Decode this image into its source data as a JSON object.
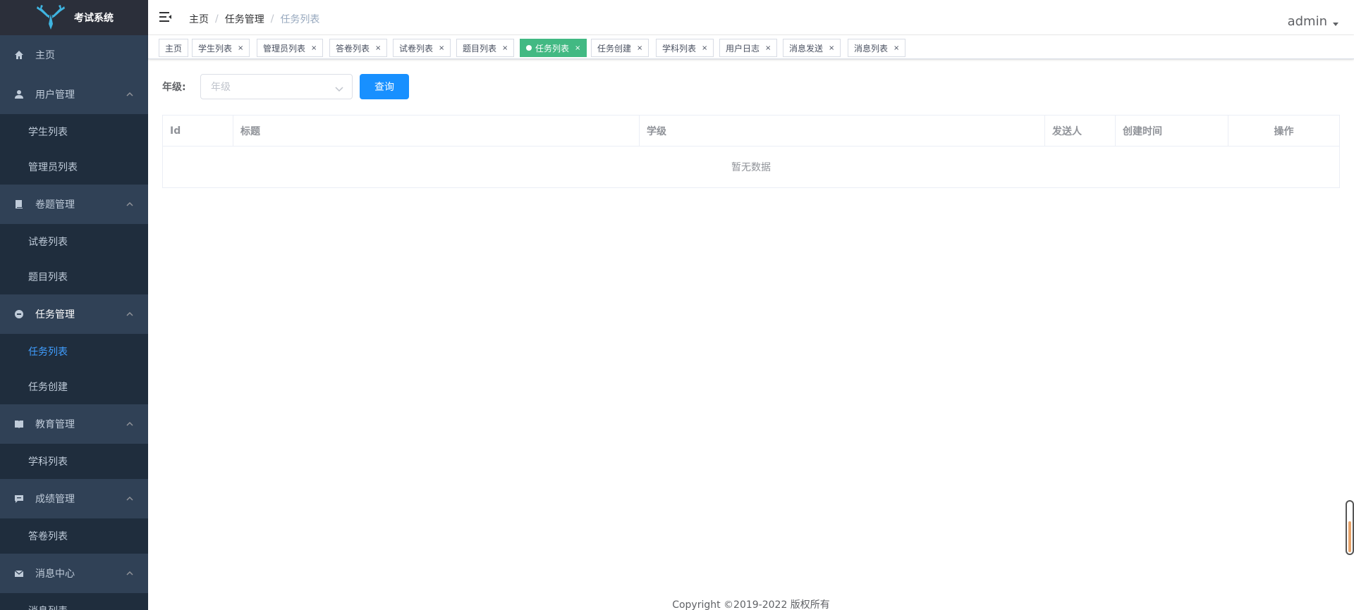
{
  "app": {
    "logo_text": "考试系统"
  },
  "sidebar": {
    "home": {
      "label": "主页",
      "icon": "home-icon"
    },
    "groups": [
      {
        "label": "用户管理",
        "icon": "user-icon",
        "items": [
          "学生列表",
          "管理员列表"
        ]
      },
      {
        "label": "卷题管理",
        "icon": "book-icon",
        "items": [
          "试卷列表",
          "题目列表"
        ]
      },
      {
        "label": "任务管理",
        "icon": "task-icon",
        "items": [
          "任务列表",
          "任务创建"
        ],
        "active_item": "任务列表"
      },
      {
        "label": "教育管理",
        "icon": "education-icon",
        "items": [
          "学科列表"
        ]
      },
      {
        "label": "成绩管理",
        "icon": "score-icon",
        "items": [
          "答卷列表"
        ]
      },
      {
        "label": "消息中心",
        "icon": "mail-icon",
        "items": [
          "消息列表"
        ]
      }
    ]
  },
  "navbar": {
    "breadcrumb": [
      "主页",
      "任务管理",
      "任务列表"
    ],
    "breadcrumb_sep": "/",
    "user": "admin"
  },
  "tags": [
    {
      "label": "主页",
      "closable": false
    },
    {
      "label": "学生列表",
      "closable": true
    },
    {
      "label": "管理员列表",
      "closable": true
    },
    {
      "label": "答卷列表",
      "closable": true
    },
    {
      "label": "试卷列表",
      "closable": true
    },
    {
      "label": "题目列表",
      "closable": true
    },
    {
      "label": "任务列表",
      "closable": true,
      "active": true
    },
    {
      "label": "任务创建",
      "closable": true
    },
    {
      "label": "学科列表",
      "closable": true
    },
    {
      "label": "用户日志",
      "closable": true
    },
    {
      "label": "消息发送",
      "closable": true
    },
    {
      "label": "消息列表",
      "closable": true
    }
  ],
  "filter": {
    "label": "年级:",
    "select_placeholder": "年级",
    "query_button": "查询"
  },
  "table": {
    "columns": [
      "Id",
      "标题",
      "学级",
      "发送人",
      "创建时间",
      "操作"
    ],
    "empty_text": "暂无数据"
  },
  "footer": {
    "copyright": "Copyright ©2019-2022 版权所有"
  },
  "colors": {
    "sidebar_bg": "#304156",
    "submenu_bg": "#1f2d3d",
    "active_text": "#409eff",
    "active_tag": "#42b983",
    "primary_button": "#1890ff"
  }
}
